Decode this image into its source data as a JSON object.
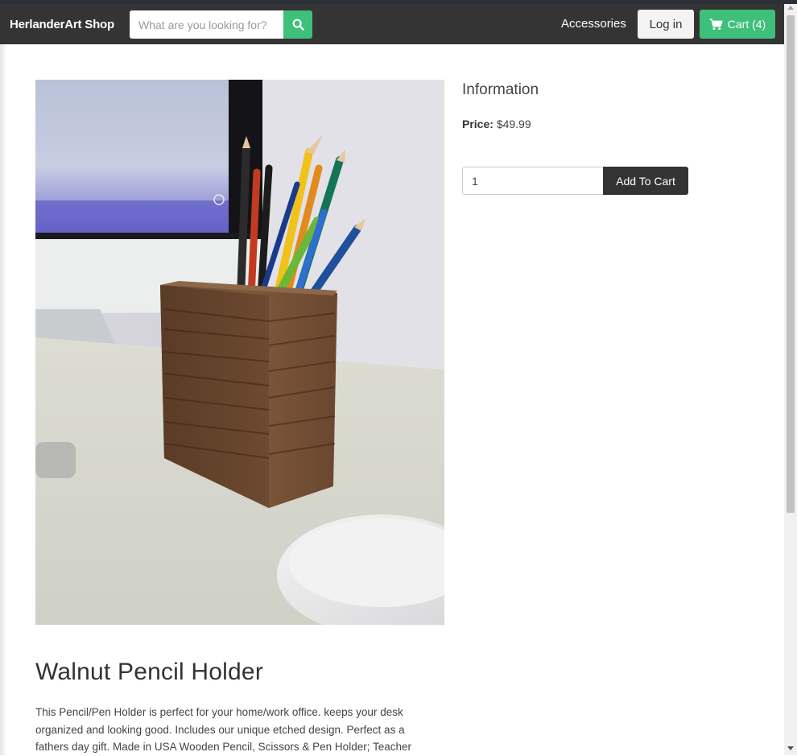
{
  "navbar": {
    "brand": "HerlanderArt Shop",
    "search_placeholder": "What are you looking for?",
    "accessories_label": "Accessories",
    "login_label": "Log in",
    "cart_label": "Cart (4)"
  },
  "info": {
    "title": "Information",
    "price_label": "Price:",
    "price_value": "$49.99",
    "quantity_value": "1",
    "add_to_cart_label": "Add To Cart"
  },
  "product": {
    "title": "Walnut Pencil Holder",
    "description": "This Pencil/Pen Holder is perfect for your home/work office. keeps your desk organized and looking good. Includes our unique etched design. Perfect as a fathers day gift. Made in USA Wooden Pencil, Scissors & Pen Holder; Teacher"
  },
  "colors": {
    "navbar_bg": "#343434",
    "accent_green": "#3ec07a",
    "dark_button": "#333333"
  },
  "icons": {
    "search": "search-icon",
    "cart": "cart-icon"
  }
}
